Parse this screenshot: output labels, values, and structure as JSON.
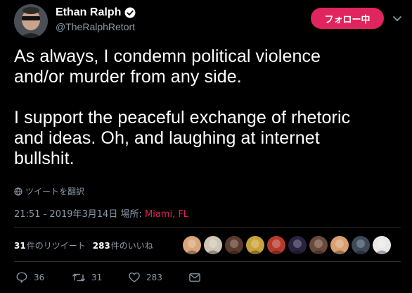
{
  "user": {
    "display_name": "Ethan Ralph",
    "handle": "@TheRalphRetort",
    "verified": true
  },
  "follow_button": {
    "label": "フォロー中"
  },
  "tweet": {
    "text": "As always, I condemn political violence\nand/or murder from any side.\n\nI support the peaceful exchange of rhetoric\nand ideas. Oh, and laughing at internet\nbullshit.",
    "translate_label": "ツイートを翻訳",
    "timestamp": "21:51 - 2019年3月14日",
    "location_label": "場所: ",
    "location": "Miami, FL"
  },
  "stats": {
    "retweets_count": "31",
    "retweets_label": "件のリツイート",
    "likes_count": "283",
    "likes_label": "件のいいね"
  },
  "actions": {
    "reply_count": "36",
    "retweet_count": "31",
    "like_count": "283"
  },
  "liker_avatars": [
    {
      "color": "#d9a57a"
    },
    {
      "color": "#cfc6b4"
    },
    {
      "color": "#5a3a2c"
    },
    {
      "color": "#c8a23a"
    },
    {
      "color": "#b53a2c"
    },
    {
      "color": "#2a2240"
    },
    {
      "color": "#6b4a3c"
    },
    {
      "color": "#d8a070"
    },
    {
      "color": "#3d4a5a"
    },
    {
      "color": "#e8e8e8"
    }
  ],
  "colors": {
    "accent": "#e0245e",
    "muted": "#8899a6",
    "background": "#000000"
  }
}
